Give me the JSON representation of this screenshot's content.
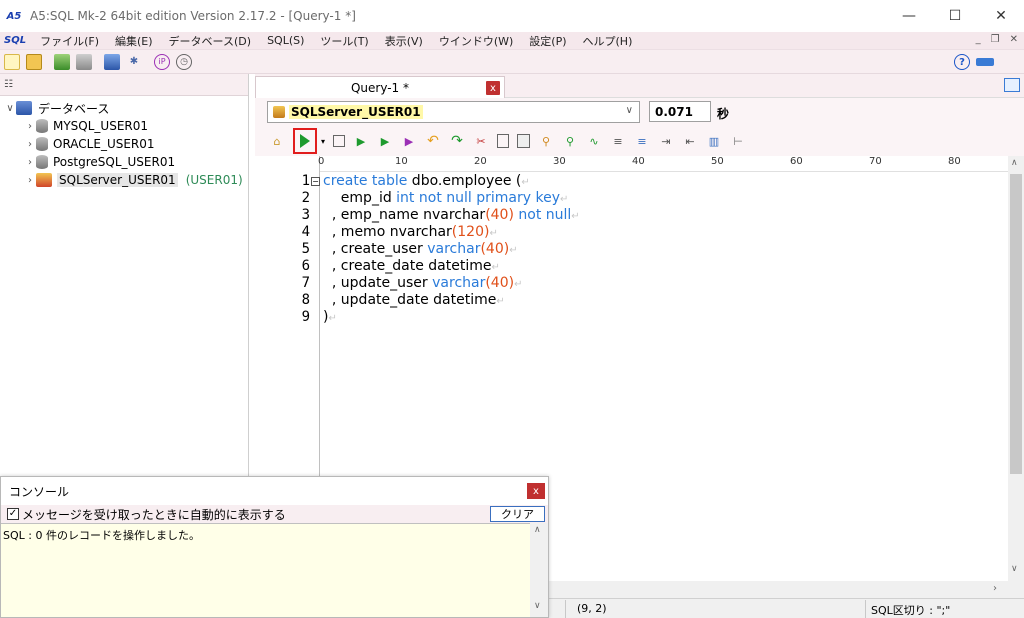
{
  "window": {
    "app_logo": "A5",
    "title": "A5:SQL Mk-2 64bit edition Version 2.17.2 - [Query-1 *]",
    "minimize": "—",
    "maximize": "☐",
    "close": "✕"
  },
  "menubar": {
    "logo": "SQL",
    "items": [
      "ファイル(F)",
      "編集(E)",
      "データベース(D)",
      "SQL(S)",
      "ツール(T)",
      "表示(V)",
      "ウインドウ(W)",
      "設定(P)",
      "ヘルプ(H)"
    ],
    "mdi_minimize": "_",
    "mdi_restore": "❐",
    "mdi_close": "✕"
  },
  "tree": {
    "root": "データベース",
    "items": [
      {
        "label": "MYSQL_USER01"
      },
      {
        "label": "ORACLE_USER01"
      },
      {
        "label": "PostgreSQL_USER01"
      },
      {
        "label": "SQLServer_USER01",
        "user": "(USER01)",
        "selected": true
      }
    ]
  },
  "tabs": [
    {
      "label": "Query-1 *",
      "close": "x"
    }
  ],
  "connection": {
    "name": "SQLServer_USER01",
    "elapsed": "0.071",
    "elapsed_unit": "秒"
  },
  "ruler": {
    "ticks": [
      "0",
      "10",
      "20",
      "30",
      "40",
      "50",
      "60",
      "70",
      "80"
    ]
  },
  "editor": {
    "line_numbers": [
      "1",
      "2",
      "3",
      "4",
      "5",
      "6",
      "7",
      "8",
      "9"
    ],
    "lines": [
      [
        {
          "t": "create table",
          "c": "kw"
        },
        {
          "t": " dbo.employee ("
        }
      ],
      [
        {
          "t": "    emp_id "
        },
        {
          "t": "int not null primary key",
          "c": "kw"
        }
      ],
      [
        {
          "t": "  , emp_name nvarchar"
        },
        {
          "t": "(40)",
          "c": "num"
        },
        {
          "t": " "
        },
        {
          "t": "not null",
          "c": "kw"
        }
      ],
      [
        {
          "t": "  , memo nvarchar"
        },
        {
          "t": "(120)",
          "c": "num"
        }
      ],
      [
        {
          "t": "  , create_user "
        },
        {
          "t": "varchar",
          "c": "kw"
        },
        {
          "t": "(40)",
          "c": "num"
        }
      ],
      [
        {
          "t": "  , create_date datetime"
        }
      ],
      [
        {
          "t": "  , update_user "
        },
        {
          "t": "varchar",
          "c": "kw"
        },
        {
          "t": "(40)",
          "c": "num"
        }
      ],
      [
        {
          "t": "  , update_date datetime"
        }
      ],
      [
        {
          "t": ")"
        }
      ]
    ],
    "eol_mark": "↵"
  },
  "status": {
    "position": "(9, 2)",
    "separator": "SQL区切り : \";\""
  },
  "console": {
    "title": "コンソール",
    "close": "x",
    "auto_show_label": "メッセージを受け取ったときに自動的に表示する",
    "auto_show_checked": "✓",
    "clear_label": "クリア",
    "message": "SQL  : 0 件のレコードを操作しました。"
  },
  "colors": {
    "menu_bg": "#f5e8ec",
    "keyword": "#2a7bd9",
    "number": "#e0501a",
    "exec_highlight": "#e11d1d"
  }
}
